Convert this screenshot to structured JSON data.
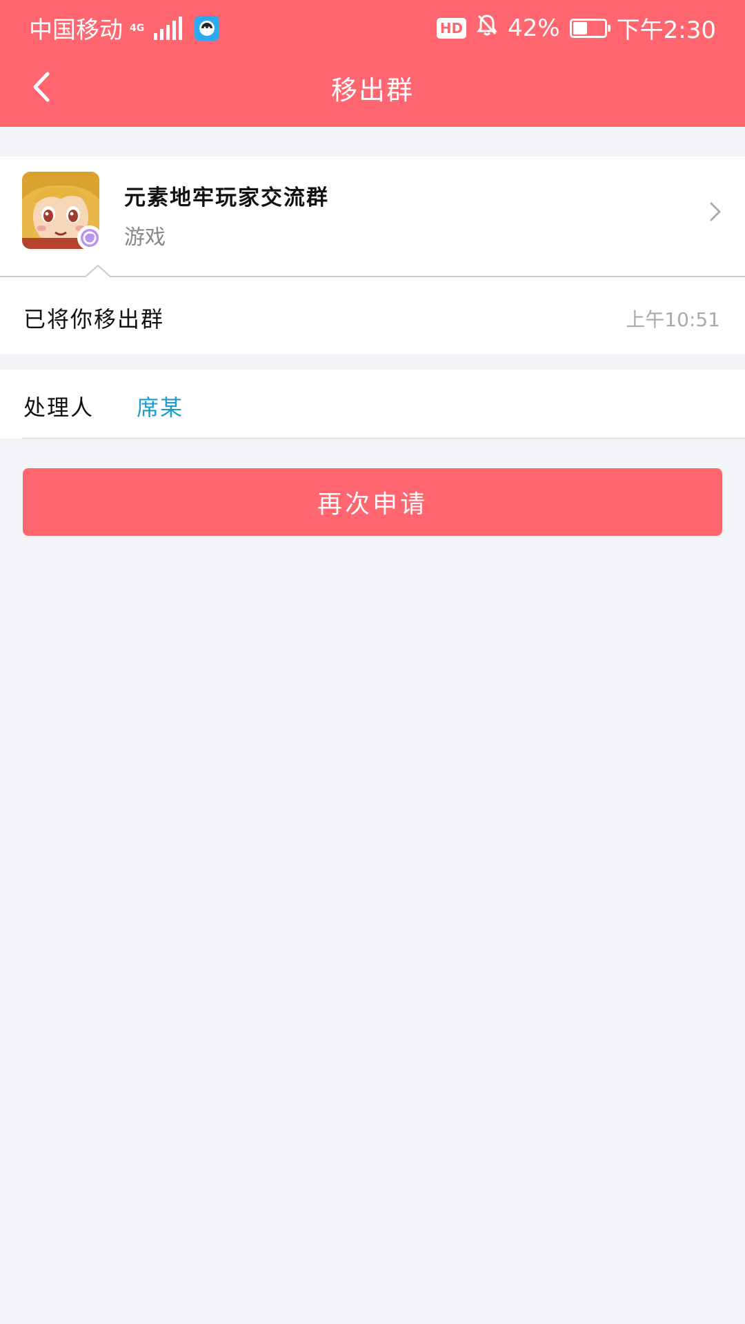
{
  "status_bar": {
    "carrier": "中国移动",
    "network": "4G",
    "hd_badge": "HD",
    "battery_percent": "42%",
    "battery_level": 0.42,
    "time": "下午2:30"
  },
  "header": {
    "title": "移出群"
  },
  "group": {
    "name": "元素地牢玩家交流群",
    "category": "游戏"
  },
  "message": {
    "text": "已将你移出群",
    "time": "上午10:51"
  },
  "handler": {
    "label": "处理人",
    "name": "席某"
  },
  "actions": {
    "reapply_label": "再次申请"
  },
  "colors": {
    "primary": "#ff6670",
    "link": "#1b9ccd",
    "background": "#f3f4f8"
  }
}
